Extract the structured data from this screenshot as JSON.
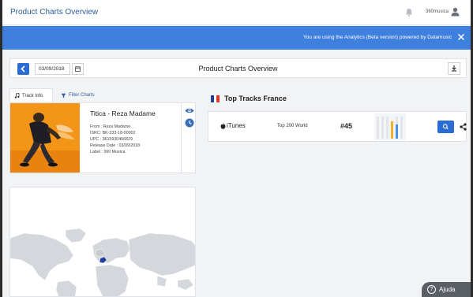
{
  "app": {
    "title": "Product Charts Overview",
    "user_name": "360musica"
  },
  "banner": {
    "message": "You are using the Analytics (Beta version) powered by Datamusic"
  },
  "page_header": {
    "date": "03/09/2018",
    "title": "Product Charts Overview"
  },
  "tabs": [
    {
      "label": "Track Info",
      "icon": "music-note-icon"
    },
    {
      "label": "Filter Charts",
      "icon": "filter-icon"
    }
  ],
  "track": {
    "title": "Titica - Reza Madame",
    "meta": [
      "From : Reza Madame",
      "ISRC: BK-333-18-00002",
      "UPC : 3615930466829",
      "Release Date : 03/09/2018",
      "Label : 360 Musica"
    ]
  },
  "top_tracks": {
    "title": "Top Tracks France",
    "flag_colors": [
      "#1f3f9c",
      "#ffffff",
      "#e0382f"
    ],
    "rows": [
      {
        "store": "iTunes",
        "chart": "Top 200 World",
        "rank": "#45"
      }
    ]
  },
  "colors": {
    "accent": "#2b6bd4",
    "banner": "#3f7fde",
    "spark_bar": "#f2b12d",
    "spark_bar_alt": "#4a90e2"
  },
  "help": {
    "label": "Ajuda"
  }
}
